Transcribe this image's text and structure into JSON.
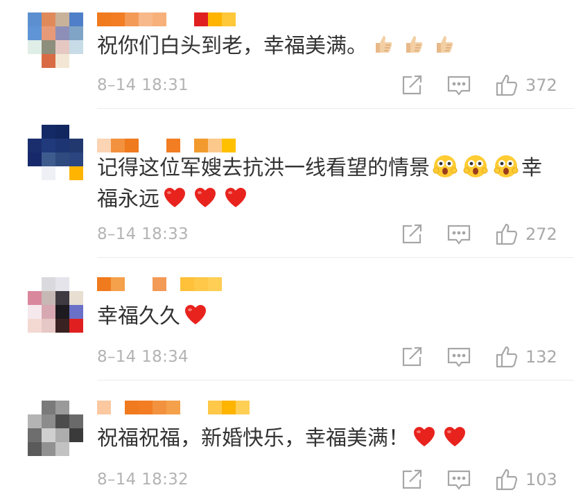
{
  "comments": [
    {
      "text": "祝你们白头到老，幸福美满。",
      "emojis": [
        "thumbs-up-icon",
        "thumbs-up-icon",
        "thumbs-up-icon"
      ],
      "time": "8–14 18:31",
      "likes": "372"
    },
    {
      "text": "记得这位军嫂去抗洪一线看望的情景",
      "emojis": [
        "star-struck-face-icon",
        "star-struck-face-icon",
        "star-struck-face-icon"
      ],
      "text_after": "幸",
      "text_line2": "福永远",
      "emojis_line2": [
        "red-heart-icon",
        "red-heart-icon",
        "red-heart-icon"
      ],
      "time": "8–14 18:33",
      "likes": "272"
    },
    {
      "text": "幸福久久",
      "emojis": [
        "red-heart-icon"
      ],
      "time": "8–14 18:34",
      "likes": "132"
    },
    {
      "text": "祝福祝福，新婚快乐，幸福美满！",
      "emojis": [
        "red-heart-icon",
        "red-heart-icon"
      ],
      "time": "8–14 18:32",
      "likes": "103"
    }
  ],
  "colors": {
    "text": "#333333",
    "meta": "#b3b3b3",
    "username_mosaic": [
      "#f07a1e",
      "#f5a04a",
      "#fbc98c",
      "#ffc000",
      "#e02020"
    ],
    "heart": "#e8231e",
    "emoji_yellow": "#ffcc33"
  }
}
